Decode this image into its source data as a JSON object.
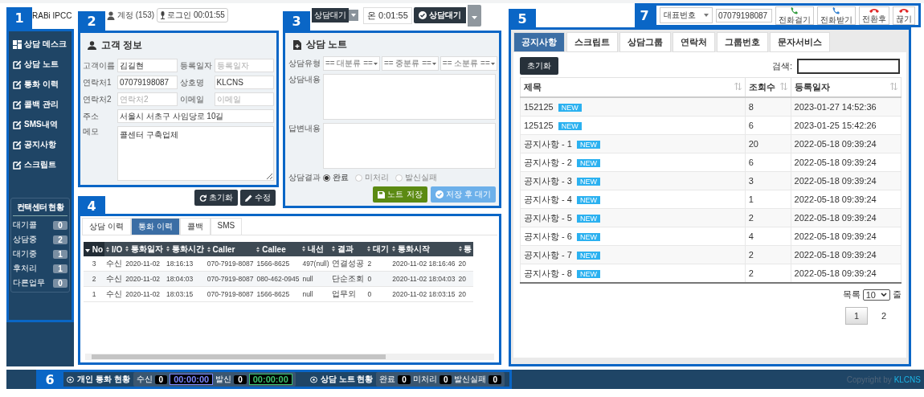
{
  "header": {
    "app_name": "RABi IPCC",
    "account": "계정 (153)",
    "login_time": "로그인 00:01:55",
    "status_chip": "상담대기",
    "status_time": "온 0:01:55",
    "status_button": "상담대기"
  },
  "annotations": [
    "1",
    "2",
    "3",
    "4",
    "5",
    "6",
    "7"
  ],
  "sidebar": {
    "items": [
      {
        "label": "상담 데스크",
        "kind": "desk",
        "selected": false
      },
      {
        "label": "상담 노트",
        "kind": "edit",
        "selected": false
      },
      {
        "label": "통화 이력",
        "kind": "edit",
        "selected": false
      },
      {
        "label": "콜백 관리",
        "kind": "edit",
        "selected": false
      },
      {
        "label": "SMS내역",
        "kind": "edit",
        "selected": false
      },
      {
        "label": "공지사항",
        "kind": "edit",
        "selected": false
      },
      {
        "label": "스크립트",
        "kind": "edit",
        "selected": false
      }
    ],
    "status_title": "컨택센터 현황",
    "status": [
      {
        "label": "대기콜",
        "value": "0"
      },
      {
        "label": "상담중",
        "value": "2"
      },
      {
        "label": "대기중",
        "value": "1"
      },
      {
        "label": "후처리",
        "value": "1"
      },
      {
        "label": "다른업무",
        "value": "0"
      }
    ]
  },
  "customer_info": {
    "title": "고객 정보",
    "fields": [
      {
        "label": "고객이름",
        "value": "김길현",
        "kind": "half"
      },
      {
        "label": "등록일자",
        "placeholder": "등록일자",
        "kind": "half"
      },
      {
        "label": "연락처1",
        "value": "07079198087",
        "kind": "half"
      },
      {
        "label": "상호명",
        "value": "KLCNS",
        "kind": "half"
      },
      {
        "label": "연락처2",
        "placeholder": "연락처2",
        "kind": "half"
      },
      {
        "label": "이메일",
        "placeholder": "이메일",
        "kind": "half"
      },
      {
        "label": "주소",
        "value": "서울시 서초구 사임당로 10길",
        "kind": "wide"
      },
      {
        "label": "메모",
        "value": "콜센터 구축업체",
        "kind": "memo"
      }
    ],
    "buttons": [
      {
        "label": "초기화",
        "kind": "reset"
      },
      {
        "label": "수정",
        "kind": "edit"
      }
    ]
  },
  "counsel_note": {
    "title": "상담 노트",
    "type_label": "상담유형",
    "selects": [
      "== 대분류 ==",
      "== 중분류 ==",
      "== 소분류 =="
    ],
    "content_label": "상담내용",
    "answer_label": "답변내용",
    "result_label": "상담결과",
    "results": [
      {
        "label": "완료",
        "selected": true
      },
      {
        "label": "미처리",
        "selected": false
      },
      {
        "label": "발신실패",
        "selected": false
      }
    ],
    "buttons": [
      {
        "label": "노트 저장",
        "kind": "save"
      },
      {
        "label": "저장 후 대기",
        "kind": "wait"
      }
    ]
  },
  "history": {
    "tabs": [
      {
        "label": "상담 이력",
        "selected": false
      },
      {
        "label": "통화 이력",
        "selected": true
      },
      {
        "label": "콜백",
        "selected": false
      },
      {
        "label": "SMS",
        "selected": false
      }
    ],
    "columns": [
      {
        "label": "No",
        "sorted": true
      },
      {
        "label": "I/O",
        "sorted": false
      },
      {
        "label": "통화일자",
        "sorted": false
      },
      {
        "label": "통화시간",
        "sorted": false
      },
      {
        "label": "Caller",
        "sorted": false
      },
      {
        "label": "Callee",
        "sorted": false
      },
      {
        "label": "내선",
        "sorted": false
      },
      {
        "label": "결과",
        "sorted": false
      },
      {
        "label": "대기",
        "sorted": false
      },
      {
        "label": "통화시작",
        "sorted": false
      },
      {
        "label": "통",
        "sorted": false
      }
    ],
    "rows": [
      [
        "3",
        "수신",
        "2020-11-02",
        "18:16:13",
        "070-7919-8087",
        "1566-8625",
        "497(null)",
        "연결성공",
        "2",
        "2020-11-02 18:16:46",
        "20"
      ],
      [
        "2",
        "수신",
        "2020-11-02",
        "18:04:03",
        "070-7919-8087",
        "080-462-0945",
        "null",
        "단순조회",
        "0",
        "2020-11-02 18:04:03",
        "20"
      ],
      [
        "1",
        "수신",
        "2020-11-02",
        "18:03:15",
        "070-7919-8087",
        "1566-8625",
        "null",
        "업무외",
        "0",
        "2020-11-02 18:03:15",
        "20"
      ]
    ]
  },
  "board": {
    "tabs": [
      {
        "label": "공지사항",
        "selected": true
      },
      {
        "label": "스크립트",
        "selected": false
      },
      {
        "label": "상담그룹",
        "selected": false
      },
      {
        "label": "연락처",
        "selected": false
      },
      {
        "label": "그룹번호",
        "selected": false
      },
      {
        "label": "문자서비스",
        "selected": false
      }
    ],
    "reset_button": "초기화",
    "search_label": "검색:",
    "columns": [
      "제목",
      "조회수",
      "등록일자"
    ],
    "rows": [
      {
        "title": "152125",
        "badge": "NEW",
        "views": "8",
        "date": "2023-01-27 14:52:36"
      },
      {
        "title": "125125",
        "badge": "NEW",
        "views": "6",
        "date": "2023-01-25 15:42:26"
      },
      {
        "title": "공지사항 - 1",
        "badge": "NEW",
        "views": "20",
        "date": "2022-05-18 09:39:24"
      },
      {
        "title": "공지사항 - 2",
        "badge": "NEW",
        "views": "6",
        "date": "2022-05-18 09:39:24"
      },
      {
        "title": "공지사항 - 3",
        "badge": "NEW",
        "views": "3",
        "date": "2022-05-18 09:39:24"
      },
      {
        "title": "공지사항 - 4",
        "badge": "NEW",
        "views": "1",
        "date": "2022-05-18 09:39:24"
      },
      {
        "title": "공지사항 - 5",
        "badge": "NEW",
        "views": "2",
        "date": "2022-05-18 09:39:24"
      },
      {
        "title": "공지사항 - 6",
        "badge": "NEW",
        "views": "4",
        "date": "2022-05-18 09:39:24"
      },
      {
        "title": "공지사항 - 7",
        "badge": "NEW",
        "views": "2",
        "date": "2022-05-18 09:39:24"
      },
      {
        "title": "공지사항 - 8",
        "badge": "NEW",
        "views": "2",
        "date": "2022-05-18 09:39:24"
      }
    ],
    "page_size_label": "목록",
    "page_size": "10",
    "page_size_unit": "줄",
    "pages": [
      {
        "label": "1",
        "selected": true
      },
      {
        "label": "2",
        "selected": false
      }
    ]
  },
  "call_bar": {
    "line_select": "대표번호",
    "number": "07079198087",
    "buttons": [
      {
        "label": "전화걸기",
        "kind": "dial"
      },
      {
        "label": "전화받기",
        "kind": "answer"
      },
      {
        "label": "전환후",
        "kind": "hangup"
      },
      {
        "label": "끊기",
        "kind": "hangup"
      }
    ]
  },
  "personal_status": {
    "title": "개인 통화 현황",
    "items": [
      {
        "label": "수신",
        "count": "0",
        "time": "00:00:00",
        "color": "#7b86ff"
      },
      {
        "label": "발신",
        "count": "0",
        "time": "00:00:00",
        "color": "#3cc46e"
      }
    ]
  },
  "note_status": {
    "title": "상담 노트 현황",
    "items": [
      {
        "label": "완료",
        "count": "0"
      },
      {
        "label": "미처리",
        "count": "0"
      },
      {
        "label": "발신실패",
        "count": "0"
      }
    ]
  },
  "footer": {
    "text": "Copyright by",
    "brand": "KLCNS"
  }
}
